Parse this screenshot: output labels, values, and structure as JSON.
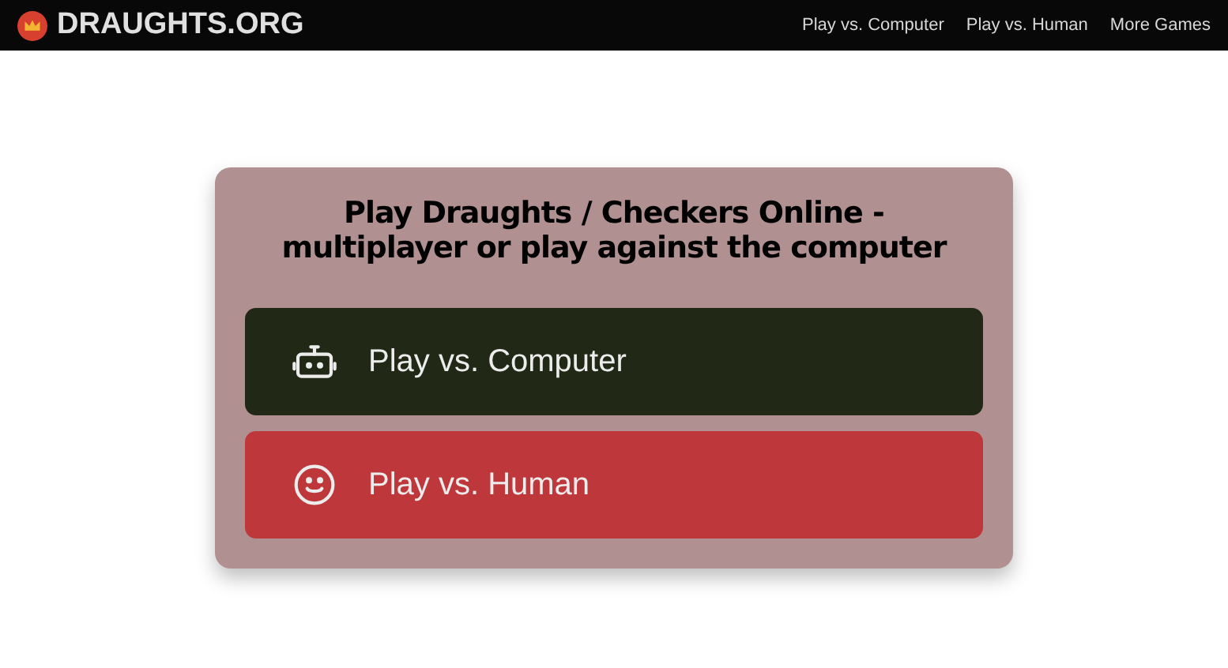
{
  "header": {
    "logo": "DRAUGHTS.ORG",
    "nav": [
      "Play vs. Computer",
      "Play vs. Human",
      "More Games"
    ]
  },
  "card": {
    "title": "Play Draughts / Checkers Online - multiplayer or play against the computer",
    "buttons": [
      {
        "label": "Play vs. Computer",
        "kind": "robot",
        "color": "#212816"
      },
      {
        "label": "Play vs. Human",
        "kind": "smiley",
        "color": "#bd373b"
      }
    ]
  }
}
